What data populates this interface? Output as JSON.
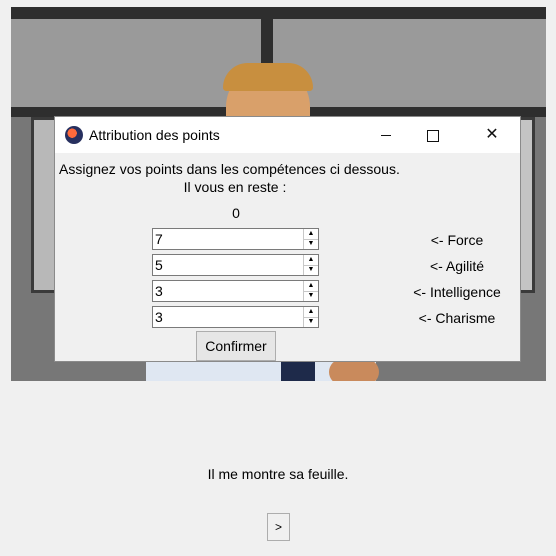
{
  "dialog": {
    "title": "Attribution des points",
    "instruction": "Assignez vos points dans les compétences ci dessous.",
    "remaining_label": "Il vous en reste :",
    "remaining_value": "0",
    "stats": [
      {
        "value": "7",
        "label": "<- Force"
      },
      {
        "value": "5",
        "label": "<- Agilité"
      },
      {
        "value": "3",
        "label": "<- Intelligence"
      },
      {
        "value": "3",
        "label": "<- Charisme"
      }
    ],
    "confirm_label": "Confirmer",
    "titlebar_icons": {
      "minimize": "minimize-icon",
      "maximize": "maximize-icon",
      "close": "close-icon"
    }
  },
  "narration": "Il me montre sa feuille.",
  "next_label": ">",
  "spin_arrows": {
    "up": "▲",
    "down": "▼"
  },
  "close_glyph": "✕"
}
